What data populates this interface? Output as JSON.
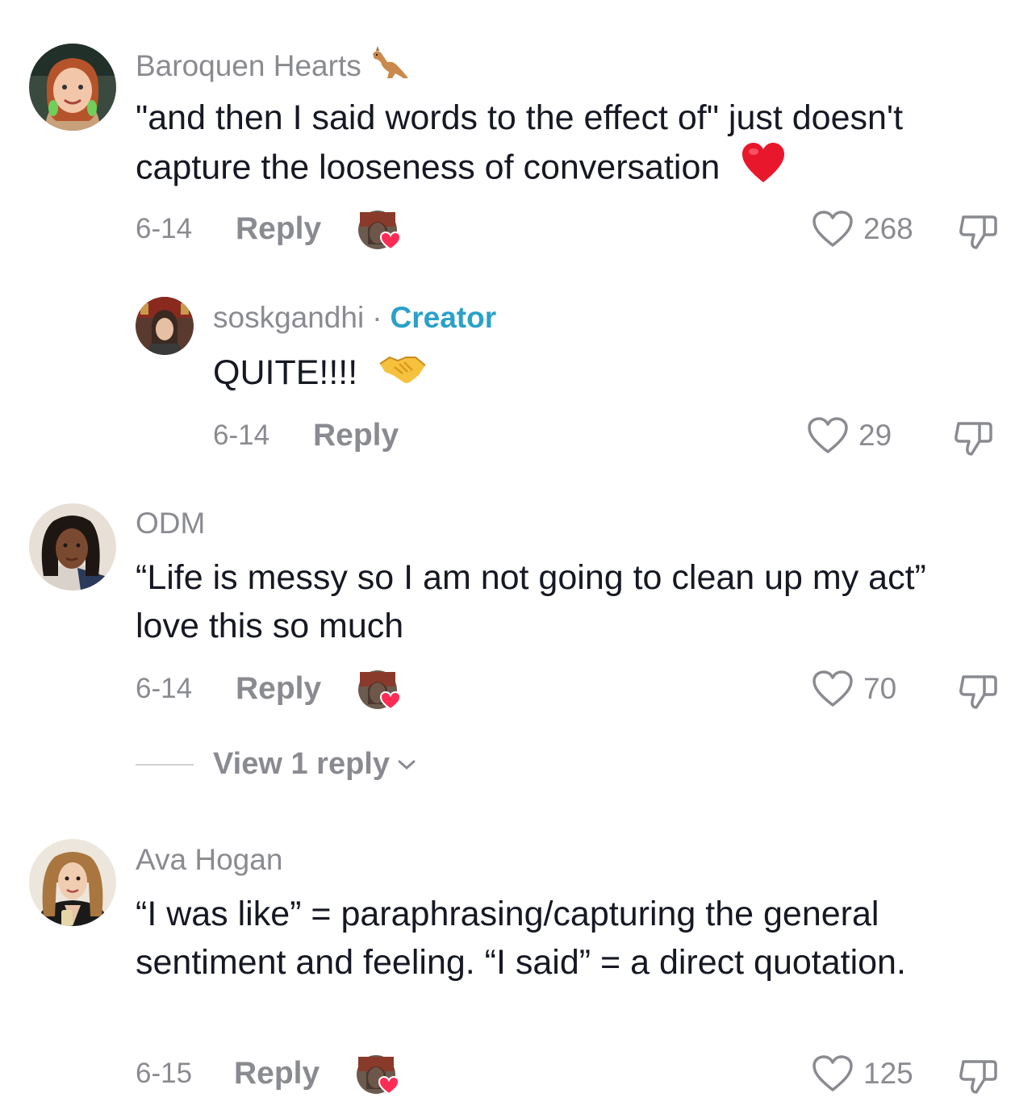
{
  "comments": [
    {
      "username": "Baroquen Hearts",
      "username_icon": "kangaroo-icon",
      "text": "\"and then I said words to the effect of\" just doesn't capture the looseness of conversation",
      "trailing_icon": "red-heart-icon",
      "date": "6-14",
      "reply_label": "Reply",
      "creator_liked": true,
      "likes": "268",
      "replies": [
        {
          "username": "soskgandhi",
          "separator": "·",
          "badge": "Creator",
          "text": "QUITE!!!!",
          "trailing_icon": "handshake-icon",
          "date": "6-14",
          "reply_label": "Reply",
          "likes": "29"
        }
      ]
    },
    {
      "username": "ODM",
      "text": "“Life is messy so I am not going to clean up my act” love this so much",
      "date": "6-14",
      "reply_label": "Reply",
      "creator_liked": true,
      "likes": "70",
      "view_replies_label": "View 1 reply"
    },
    {
      "username": "Ava Hogan",
      "text": "“I was like” = paraphrasing/capturing the general sentiment and feeling. “I said” = a direct quotation.",
      "date": "6-15",
      "reply_label": "Reply",
      "creator_liked": true,
      "likes": "125"
    }
  ],
  "colors": {
    "username": "#8a8b91",
    "creator_badge": "#2aa1c9",
    "body": "#161823",
    "creator_like_heart": "#fe2c55"
  }
}
